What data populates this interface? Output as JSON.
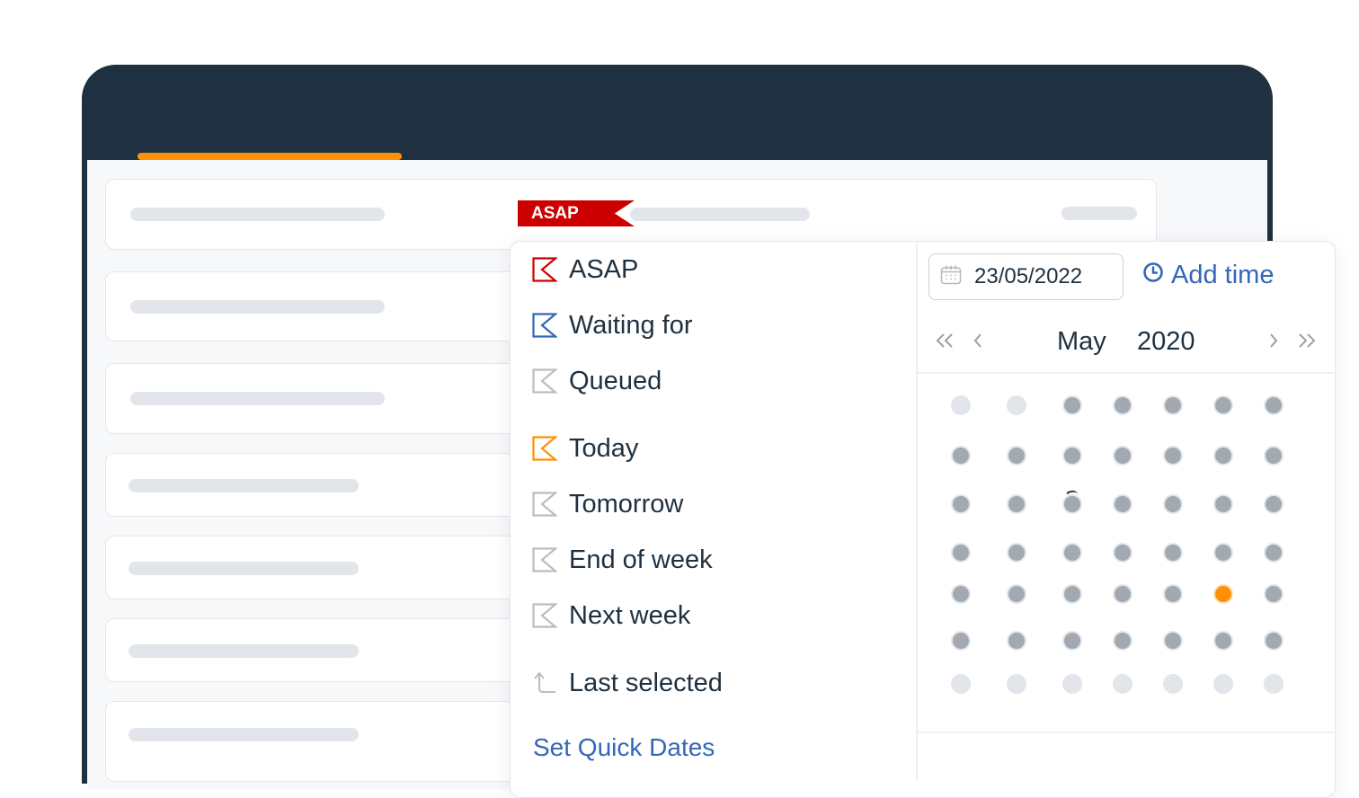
{
  "colors": {
    "frame": "#1f3140",
    "accent": "#ff9008",
    "asap_red": "#cc0000",
    "link_blue": "#3467b8",
    "text_dark": "#1f3140",
    "day_dot": "#a2a9b0",
    "day_dot_muted": "#e2e5ea"
  },
  "badge": {
    "label": "ASAP"
  },
  "quick_dates": {
    "items": [
      {
        "label": "ASAP",
        "icon": "flag-icon",
        "color": "#cc0000"
      },
      {
        "label": "Waiting for",
        "icon": "flag-icon",
        "color": "#3467b8"
      },
      {
        "label": "Queued",
        "icon": "flag-icon",
        "color": "#b9bec4"
      },
      {
        "label": "Today",
        "icon": "flag-icon",
        "color": "#ff9008"
      },
      {
        "label": "Tomorrow",
        "icon": "flag-icon",
        "color": "#b9bec4"
      },
      {
        "label": "End of week",
        "icon": "flag-icon",
        "color": "#b9bec4"
      },
      {
        "label": "Next week",
        "icon": "flag-icon",
        "color": "#b9bec4"
      },
      {
        "label": "Last selected",
        "icon": "return-arrow-icon",
        "color": "#b9bec4"
      }
    ],
    "set_link": "Set Quick Dates"
  },
  "date_picker": {
    "input_value": "23/05/2022",
    "input_icon": "calendar-icon",
    "add_time_label": "Add time",
    "add_time_icon": "clock-icon",
    "month": "May",
    "year": "2020",
    "nav": {
      "prev_year_icon": "double-chevron-left-icon",
      "prev_month_icon": "chevron-left-icon",
      "next_month_icon": "chevron-right-icon",
      "next_year_icon": "double-chevron-right-icon"
    },
    "weeks": [
      [
        "out",
        "in",
        "in",
        "in",
        "in",
        "in",
        "in"
      ],
      [
        "in",
        "in",
        "in",
        "in",
        "in",
        "in",
        "in"
      ],
      [
        "in",
        "in",
        "in",
        "in",
        "in",
        "in",
        "in"
      ],
      [
        "in",
        "in",
        "in",
        "in",
        "in",
        "in",
        "in"
      ],
      [
        "in",
        "in",
        "in",
        "in",
        "in",
        "selected",
        "in"
      ],
      [
        "in",
        "in",
        "in",
        "in",
        "in",
        "in",
        "in"
      ],
      [
        "out",
        "out",
        "out",
        "out",
        "out",
        "out",
        "out"
      ]
    ],
    "first_week_override": [
      "out",
      "out",
      "in",
      "in",
      "in",
      "in",
      "in"
    ]
  }
}
